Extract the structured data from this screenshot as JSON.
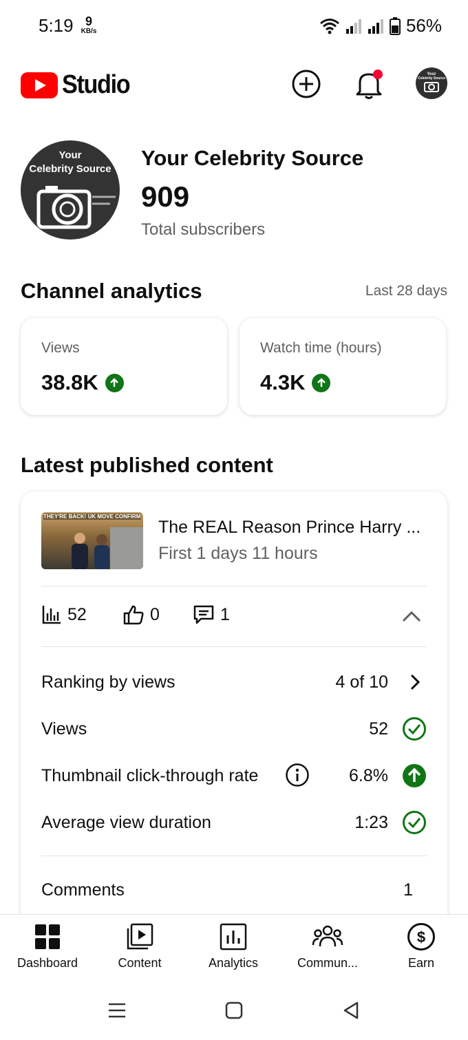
{
  "status_bar": {
    "time": "5:19",
    "net_speed_value": "9",
    "net_speed_unit": "KB/s",
    "battery_percent": "56%"
  },
  "app_bar": {
    "logo_text": "Studio",
    "create_icon": "add-circle-icon",
    "notifications_icon": "bell-icon",
    "notification_dot_color": "#ff0033",
    "avatar_text": "Your Celebrity Source"
  },
  "channel": {
    "avatar_text_line1": "Your",
    "avatar_text_line2": "Celebrity Source",
    "name": "Your Celebrity Source",
    "subscribers": "909",
    "subscribers_label": "Total subscribers"
  },
  "analytics": {
    "title": "Channel analytics",
    "period": "Last 28 days",
    "cards": [
      {
        "label": "Views",
        "value": "38.8K",
        "trend": "up"
      },
      {
        "label": "Watch time (hours)",
        "value": "4.3K",
        "trend": "up"
      }
    ]
  },
  "latest": {
    "title": "Latest published content",
    "video": {
      "thumbnail_caption": "THEY'RE BACK! UK MOVE CONFIRMED",
      "title": "The REAL Reason Prince Harry ...",
      "age": "First 1 days 11 hours"
    },
    "stats": {
      "views": "52",
      "likes": "0",
      "comments": "1"
    },
    "rows": [
      {
        "label": "Ranking by views",
        "value": "4 of 10",
        "icon": "chevron-right-icon"
      },
      {
        "label": "Views",
        "value": "52",
        "icon": "check-circle-icon"
      },
      {
        "label": "Thumbnail click-through rate",
        "value": "6.8%",
        "icon": "arrow-up-circle-icon"
      },
      {
        "label": "Average view duration",
        "value": "1:23",
        "icon": "check-circle-icon"
      }
    ],
    "comments_row": {
      "label": "Comments",
      "value": "1"
    }
  },
  "bottom_nav": {
    "items": [
      {
        "label": "Dashboard",
        "icon": "dashboard-icon",
        "active": true
      },
      {
        "label": "Content",
        "icon": "content-icon"
      },
      {
        "label": "Analytics",
        "icon": "analytics-icon"
      },
      {
        "label": "Commun...",
        "icon": "community-icon"
      },
      {
        "label": "Earn",
        "icon": "earn-icon"
      }
    ]
  },
  "colors": {
    "youtube_red": "#ff0000",
    "positive_green": "#107516",
    "secondary_text": "#606060"
  }
}
